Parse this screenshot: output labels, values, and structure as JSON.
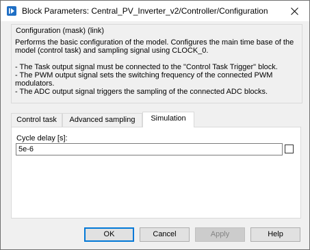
{
  "window": {
    "title": "Block Parameters: Central_PV_Inverter_v2/Controller/Configuration"
  },
  "mask": {
    "group_label": "Configuration (mask) (link)",
    "description": [
      "Performs the basic configuration of the model. Configures the main time base of the model (control task) and sampling signal using CLOCK_0.",
      "",
      "- The Task output signal must be connected to the \"Control Task Trigger\" block.",
      "- The PWM output signal sets the switching frequency of the connected PWM modulators.",
      "- The ADC output signal triggers the sampling of the connected ADC blocks."
    ]
  },
  "tabs": [
    {
      "label": "Control task",
      "active": false
    },
    {
      "label": "Advanced sampling",
      "active": false
    },
    {
      "label": "Simulation",
      "active": true
    }
  ],
  "parameters": {
    "cycle_delay": {
      "label": "Cycle delay [s]:",
      "value": "5e-6",
      "checked": false
    }
  },
  "buttons": {
    "ok": "OK",
    "cancel": "Cancel",
    "apply": "Apply",
    "help": "Help"
  },
  "icons": {
    "app": "simulink-block-icon",
    "close": "close-icon"
  },
  "colors": {
    "accent": "#0078d7",
    "app_icon": "#1f6fc5"
  }
}
